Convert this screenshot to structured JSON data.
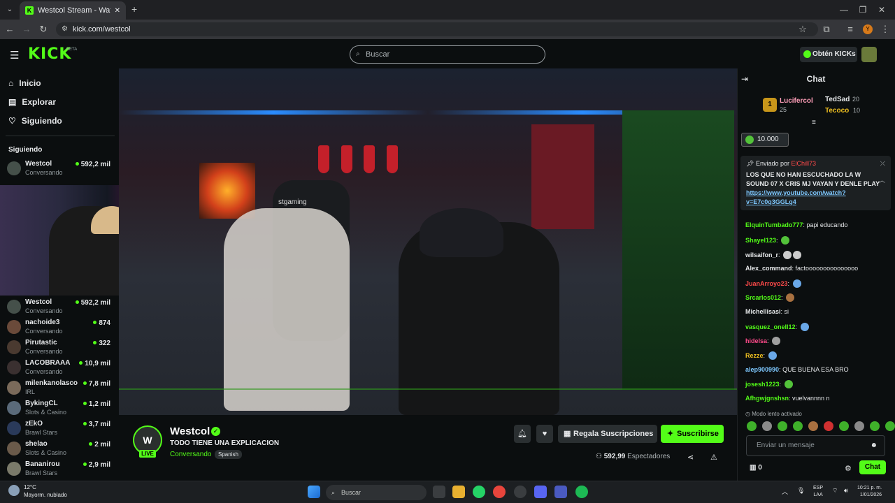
{
  "browser": {
    "tab_title": "Westcol Stream - Watch Live o",
    "url": "kick.com/westcol",
    "new_tab": "+"
  },
  "header": {
    "logo": "KICK",
    "beta": "BETA",
    "search_placeholder": "Buscar",
    "get_kicks": "Obtén KICKs"
  },
  "sidebar": {
    "nav": [
      {
        "label": "Inicio",
        "icon": "home-icon"
      },
      {
        "label": "Explorar",
        "icon": "explore-icon"
      },
      {
        "label": "Siguiendo",
        "icon": "heart-icon"
      }
    ],
    "following_heading": "Siguiendo",
    "pinned_channel": {
      "name": "Westcol",
      "category": "Conversando",
      "viewers": "592,2 mil"
    },
    "channels": [
      {
        "name": "Westcol",
        "category": "Conversando",
        "viewers": "592,2 mil"
      },
      {
        "name": "nachoide3",
        "category": "Conversando",
        "viewers": "874"
      },
      {
        "name": "Pirutastic",
        "category": "Conversando",
        "viewers": "322"
      },
      {
        "name": "LACOBRAAA",
        "category": "Conversando",
        "viewers": "10,9 mil"
      },
      {
        "name": "milenkanolasco",
        "category": "IRL",
        "viewers": "7,8 mil"
      },
      {
        "name": "BykingCL",
        "category": "Slots & Casino",
        "viewers": "1,2 mil"
      },
      {
        "name": "zEkO",
        "category": "Brawl Stars",
        "viewers": "3,7 mil"
      },
      {
        "name": "shelao",
        "category": "Slots & Casino",
        "viewers": "2 mil"
      },
      {
        "name": "Bananirou",
        "category": "Brawl Stars",
        "viewers": "2,9 mil"
      }
    ]
  },
  "video": {
    "chair_brand": "stgaming"
  },
  "channel": {
    "avatar_text": "W",
    "live": "LIVE",
    "name": "Westcol",
    "title": "TODO TIENE UNA EXPLICACION",
    "category": "Conversando",
    "tag": "Spanish",
    "gift_label": "Regala Suscripciones",
    "subscribe_label": "Suscribirse",
    "viewers_count": "592‚99",
    "viewers_label": "Espectadores"
  },
  "chat": {
    "title": "Chat",
    "leaderboard": {
      "first": {
        "rank": "1",
        "name": "Lucifercol",
        "value": "25"
      },
      "second": {
        "name": "TedSad",
        "value": "20"
      },
      "third": {
        "name": "Tecoco",
        "value": "10"
      }
    },
    "kicks_value": "10.000",
    "pinned": {
      "sent_by": "Enviado por",
      "sender": "ElChill73",
      "message": "LOS QUE NO HAN ESCUCHADO LA W SOUND 07 X CRIS MJ VAYAN Y DENLE PLAY",
      "link": "https://www.youtube.com/watch?v=E7c0q3GGLg4"
    },
    "messages": [
      {
        "user": "ElquinTumbado777",
        "color": "#53fc18",
        "text": "papi educando"
      },
      {
        "user": "Shayel123",
        "color": "#53fc18",
        "text": ""
      },
      {
        "user": "wilsaifon_r",
        "color": "#e6e8ea",
        "text": ""
      },
      {
        "user": "Alex_command",
        "color": "#e6e8ea",
        "text": "factooooooooooooooo"
      },
      {
        "user": "JuanArroyo23",
        "color": "#ff4a4a",
        "text": ""
      },
      {
        "user": "Srcarlos012",
        "color": "#53fc18",
        "text": ""
      },
      {
        "user": "Michellisasi",
        "color": "#e6e8ea",
        "text": "si"
      },
      {
        "user": "vasquez_onell12",
        "color": "#53fc18",
        "text": ""
      },
      {
        "user": "hidelsa",
        "color": "#ff4a8a",
        "text": ""
      },
      {
        "user": "Rezze",
        "color": "#f0c020",
        "text": ""
      },
      {
        "user": "alep900990",
        "color": "#7ec8ff",
        "text": "QUE BUENA ESA BRO"
      },
      {
        "user": "josesh1223",
        "color": "#53fc18",
        "text": ""
      },
      {
        "user": "Afhgwjgnshsn",
        "color": "#53fc18",
        "text": "vuelvannnn n"
      }
    ],
    "slow_mode": "Modo lento activado",
    "input_placeholder": "Enviar un mensaje",
    "count": "0",
    "send_label": "Chat"
  },
  "taskbar": {
    "weather_temp": "12°C",
    "weather_desc": "Mayorm. nublado",
    "search": "Buscar",
    "lang1": "ESP",
    "lang2": "LAA",
    "time": "10:21 p. m.",
    "date": "1/01/2026"
  },
  "colors": {
    "accent": "#53fc18",
    "background": "#0b0e0f"
  }
}
